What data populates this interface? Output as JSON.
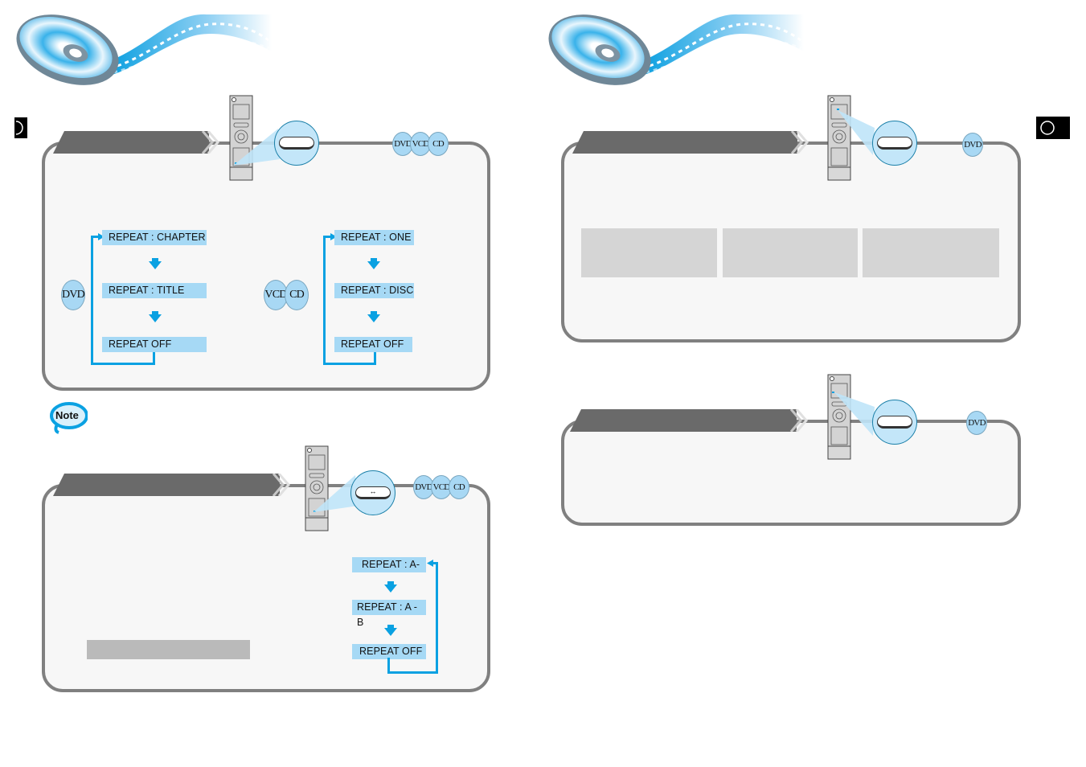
{
  "page": {
    "left_page_marker": "D",
    "right_page_marker": "O",
    "banner_icon": "disc-filmstrip-banner"
  },
  "colors": {
    "accent_blue": "#0aa1e2",
    "step_fill": "#a6d9f5",
    "panel_border": "#808080",
    "panel_fill": "#f7f7f7",
    "title_bar": "#6a6a6a",
    "disc_badge": "#a8d8f4"
  },
  "sections": {
    "repeat_playback": {
      "remote_icon": "remote-control",
      "button_label": "",
      "disc_badges": [
        "DVD",
        "VCD",
        "CD"
      ],
      "dvd_flow": {
        "badge": "DVD",
        "steps": [
          "REPEAT : CHAPTER",
          "REPEAT : TITLE",
          "REPEAT OFF"
        ]
      },
      "vcd_cd_flow": {
        "badges": [
          "VCD",
          "CD"
        ],
        "steps": [
          "REPEAT : ONE",
          "REPEAT : DISC",
          "REPEAT OFF"
        ]
      }
    },
    "note": {
      "label": "Note"
    },
    "ab_repeat": {
      "remote_icon": "remote-control",
      "button_label": "↔",
      "disc_badges": [
        "DVD",
        "VCD",
        "CD"
      ],
      "steps": [
        "REPEAT : A-",
        "REPEAT : A - B",
        "REPEAT OFF"
      ]
    },
    "angle_function": {
      "remote_icon": "remote-control",
      "button_label": "",
      "disc_badges": [
        "DVD"
      ],
      "screens": [
        "",
        "",
        ""
      ]
    },
    "zoom_function": {
      "remote_icon": "remote-control",
      "button_label": "",
      "disc_badges": [
        "DVD"
      ]
    }
  }
}
